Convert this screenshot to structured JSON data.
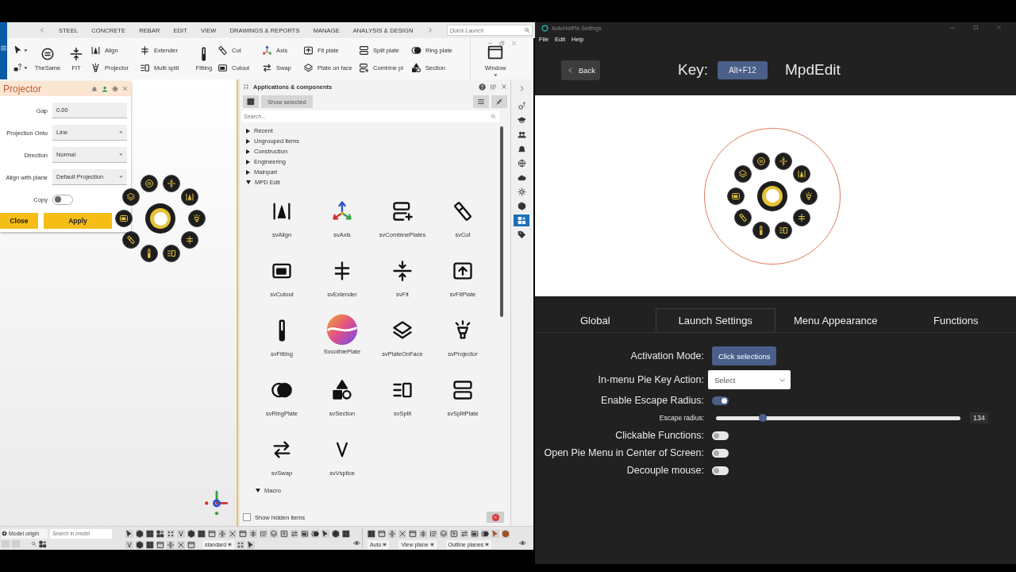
{
  "left_app": {
    "ribbon_tabs": [
      "STEEL",
      "CONCRETE",
      "REBAR",
      "EDIT",
      "VIEW",
      "DRAWINGS & REPORTS",
      "MANAGE",
      "ANALYSIS & DESIGN"
    ],
    "quick_launch": {
      "placeholder": "Quick Launch"
    },
    "tool_columns": [
      {
        "kind": "large",
        "tools": [
          "TheSame"
        ]
      },
      {
        "kind": "large",
        "tools": [
          "FIT"
        ]
      },
      {
        "kind": "stacked",
        "tools": [
          "Align",
          "Projector"
        ]
      },
      {
        "kind": "stacked",
        "tools": [
          "Extender",
          "Multi split"
        ]
      },
      {
        "kind": "large",
        "tools": [
          "Fitting"
        ]
      },
      {
        "kind": "stacked",
        "tools": [
          "Cut",
          "Cutout"
        ]
      },
      {
        "kind": "stacked",
        "tools": [
          "Axis",
          "Swap"
        ]
      },
      {
        "kind": "stacked",
        "tools": [
          "Fit plate",
          "Plate on face"
        ]
      },
      {
        "kind": "stacked",
        "tools": [
          "Split plate",
          "Combine pl"
        ]
      },
      {
        "kind": "stacked",
        "tools": [
          "Ring plate",
          "Section"
        ]
      },
      {
        "kind": "window",
        "tools": [
          "Window"
        ]
      }
    ],
    "projector_panel": {
      "title": "Projector",
      "fields": [
        {
          "label": "Gap",
          "kind": "text",
          "value": "0.00"
        },
        {
          "label": "Projection Onto",
          "kind": "select",
          "value": "Line"
        },
        {
          "label": "Direction",
          "kind": "select",
          "value": "Normal"
        },
        {
          "label": "Align with plane",
          "kind": "select",
          "value": "Default Projection"
        },
        {
          "label": "Copy",
          "kind": "toggle",
          "on": false
        }
      ],
      "buttons": [
        "Close",
        "Apply"
      ]
    },
    "apps_panel": {
      "title": "Applications & components",
      "show_selected": "Show selected",
      "search": {
        "placeholder": "Search..."
      },
      "tree": [
        {
          "label": "Recent",
          "expanded": false
        },
        {
          "label": "Ungrouped items",
          "expanded": false
        },
        {
          "label": "Construction",
          "expanded": false
        },
        {
          "label": "Engineering",
          "expanded": false
        },
        {
          "label": "Mainpart",
          "expanded": false
        },
        {
          "label": "MPD Edit",
          "expanded": true,
          "components": [
            "svAlign",
            "svAxis",
            "svCombinePlates",
            "svCut",
            "svCutout",
            "svExtender",
            "svFit",
            "svFitPlate",
            "svFitting",
            "SvoothiePlate",
            "svPlateOnFace",
            "svProjector",
            "svRingPlate",
            "svSection",
            "svSplit",
            "svSplitPlate",
            "svSwap",
            "svVsplice"
          ]
        },
        {
          "label": "Macro",
          "expanded": true
        }
      ],
      "show_hidden": {
        "label": "Show hidden items",
        "checked": false
      }
    },
    "side_tools": [
      {
        "selected": false
      },
      {
        "selected": false
      },
      {
        "selected": false
      },
      {
        "selected": false
      },
      {
        "selected": false
      },
      {
        "selected": false
      },
      {
        "selected": false
      },
      {
        "selected": false
      },
      {
        "selected": true
      },
      {
        "selected": false
      }
    ],
    "status_bar": {
      "model_origin": "Model origin",
      "search": {
        "placeholder": "Search in model"
      },
      "view_style": "standard",
      "dropdowns": [
        "Auto",
        "View plane",
        "Outline planes"
      ]
    }
  },
  "right_app": {
    "title": "AutoHotPie Settings",
    "menu": [
      "File",
      "Edit",
      "Help"
    ],
    "back": "Back",
    "key_label": "Key:",
    "key": "Alt+F12",
    "profile": "MpdEdit",
    "tabs": [
      {
        "label": "Global",
        "selected": false
      },
      {
        "label": "Launch Settings",
        "selected": true
      },
      {
        "label": "Menu Appearance",
        "selected": false
      },
      {
        "label": "Functions",
        "selected": false
      }
    ],
    "settings": [
      {
        "label": "Activation Mode:",
        "kind": "button",
        "value": "Click selections"
      },
      {
        "label": "In-menu Pie Key Action:",
        "kind": "select",
        "value": "Select"
      },
      {
        "label": "Enable Escape Radius:",
        "kind": "toggle",
        "on": true
      },
      {
        "label": "Escape radius:",
        "kind": "slider",
        "level": 0.19,
        "reading": "134"
      },
      {
        "label": "Clickable Functions:",
        "kind": "toggle",
        "on": false
      },
      {
        "label": "Open Pie Menu in Center of Screen:",
        "kind": "toggle",
        "on": false
      },
      {
        "label": "Decouple mouse:",
        "kind": "toggle",
        "on": false
      }
    ]
  }
}
